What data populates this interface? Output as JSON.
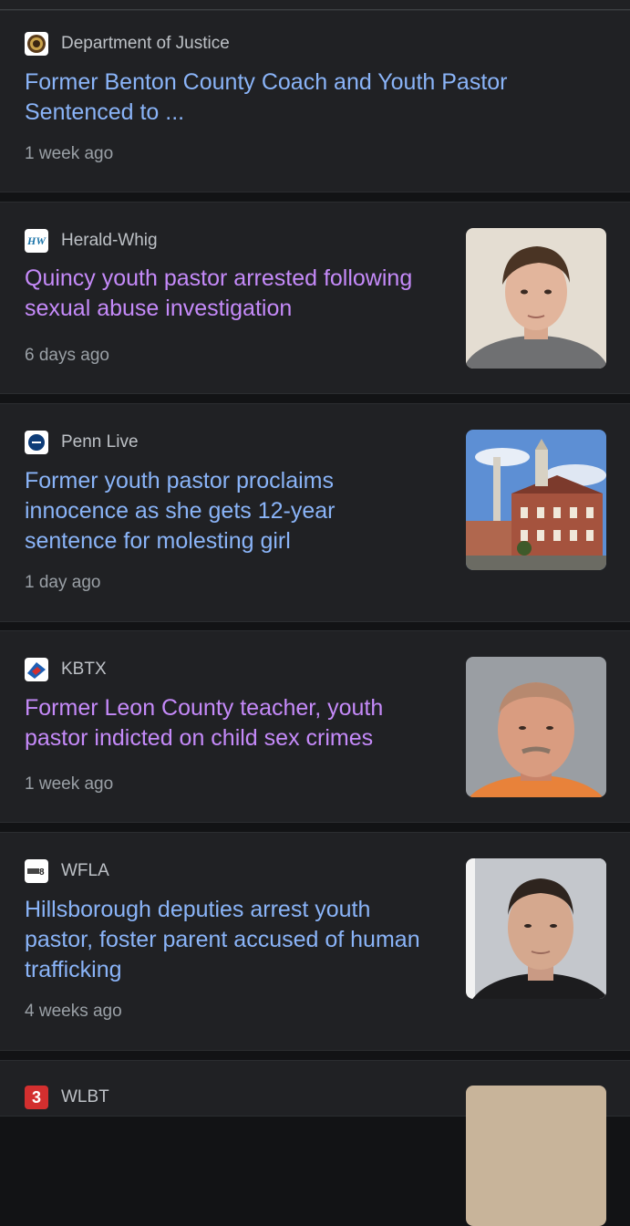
{
  "results": [
    {
      "source": "Department of Justice",
      "favicon": "doj-seal-icon",
      "headline": "Former Benton County Coach and Youth Pastor Sentenced to ...",
      "time": "1 week ago",
      "visited": false
    },
    {
      "source": "Herald-Whig",
      "favicon": "herald-whig-logo-icon",
      "favicon_text": "HW",
      "headline": "Quincy youth pastor arrested following sexual abuse investigation",
      "time": "6 days ago",
      "visited": true,
      "thumbnail": "mugshot-young-man"
    },
    {
      "source": "Penn Live",
      "favicon": "penn-live-logo-icon",
      "headline": "Former youth pastor proclaims innocence as she gets 12-year sentence for molesting girl",
      "time": "1 day ago",
      "visited": false,
      "thumbnail": "courthouse-building"
    },
    {
      "source": "KBTX",
      "favicon": "kbtx-logo-icon",
      "headline": "Former Leon County teacher, youth pastor indicted on child sex crimes",
      "time": "1 week ago",
      "visited": true,
      "thumbnail": "mugshot-older-man"
    },
    {
      "source": "WFLA",
      "favicon": "wfla-logo-icon",
      "headline": "Hillsborough deputies arrest youth pastor, foster parent accused of human trafficking",
      "time": "4 weeks ago",
      "visited": false,
      "thumbnail": "mugshot-man-dark-hair"
    },
    {
      "source": "WLBT",
      "favicon": "wlbt-logo-icon",
      "favicon_text": "3",
      "partial": true,
      "thumbnail": "partial-thumbnail"
    }
  ],
  "colors": {
    "link": "#8ab4f8",
    "visited_link": "#c58af9",
    "card_bg": "#202124",
    "page_bg": "#121315"
  }
}
